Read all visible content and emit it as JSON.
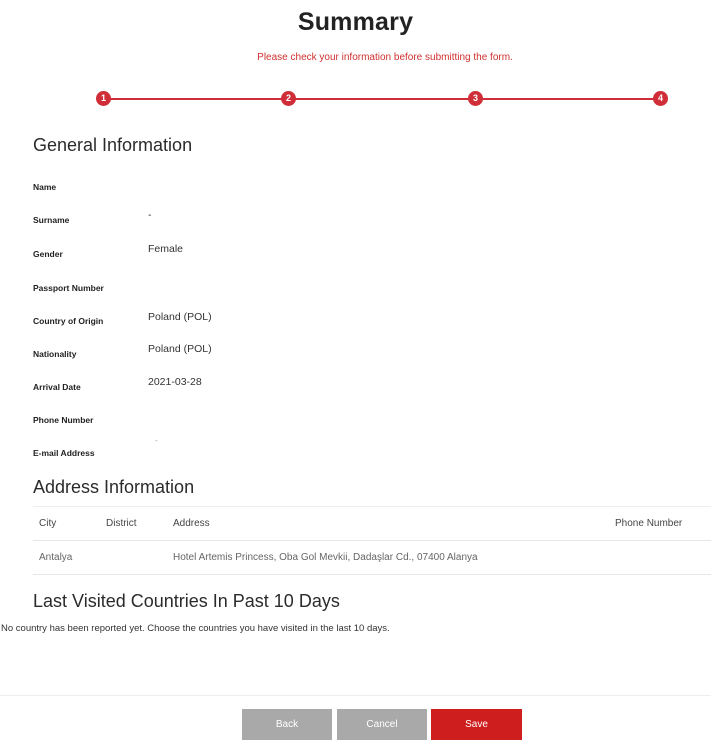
{
  "page": {
    "title": "Summary",
    "subtitle": "Please check your information before submitting the form."
  },
  "stepper": {
    "steps": [
      "1",
      "2",
      "3",
      "4"
    ],
    "color": "#cf2e38"
  },
  "general": {
    "title": "General Information",
    "fields": [
      {
        "label": "Name",
        "value": ""
      },
      {
        "label": "Surname",
        "value": "-"
      },
      {
        "label": "Gender",
        "value": "Female"
      },
      {
        "label": "Passport Number",
        "value": ""
      },
      {
        "label": "Country of Origin",
        "value": "Poland (POL)"
      },
      {
        "label": "Nationality",
        "value": "Poland (POL)"
      },
      {
        "label": "Arrival Date",
        "value": "2021-03-28"
      },
      {
        "label": "Phone Number",
        "value": ""
      },
      {
        "label": "E-mail Address",
        "value": "-"
      }
    ]
  },
  "address": {
    "title": "Address Information",
    "columns": [
      "City",
      "District",
      "Address",
      "Phone Number"
    ],
    "rows": [
      [
        "Antalya",
        "",
        "Hotel Artemis Princess, Oba Gol Mevkii, Dadaşlar Cd., 07400 Alanya",
        ""
      ]
    ]
  },
  "visited": {
    "title": "Last Visited Countries In Past 10 Days",
    "note": "No country has been reported yet. Choose the countries you have visited in the last 10 days."
  },
  "buttons": {
    "back": "Back",
    "cancel": "Cancel",
    "save": "Save",
    "save_color": "#cf1e1e",
    "secondary_color": "#a9a9a9"
  }
}
